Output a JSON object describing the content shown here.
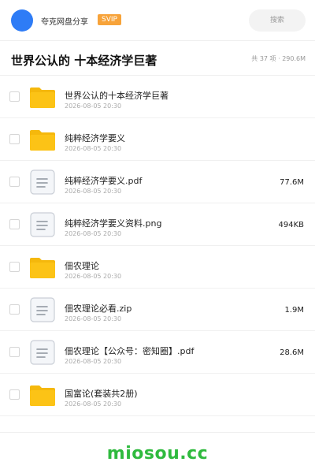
{
  "header": {
    "owner": "夸克网盘分享",
    "badge": "SVIP",
    "search_placeholder": "搜索"
  },
  "folder": {
    "title": "世界公认的 十本经济学巨著",
    "meta": "共 37 项 · 290.6M"
  },
  "files": [
    {
      "type": "folder-icon",
      "name": "世界公认的十本经济学巨著",
      "date": "2026-08-05 20:30",
      "size": ""
    },
    {
      "type": "folder-icon",
      "name": "纯粹经济学要义",
      "date": "2026-08-05 20:30",
      "size": ""
    },
    {
      "type": "document-icon",
      "name": "纯粹经济学要义.pdf",
      "date": "2026-08-05 20:30",
      "size": "77.6M"
    },
    {
      "type": "document-icon",
      "name": "纯粹经济学要义资料.png",
      "date": "2026-08-05 20:30",
      "size": "494KB"
    },
    {
      "type": "folder-icon",
      "name": "佃农理论",
      "date": "2026-08-05 20:30",
      "size": ""
    },
    {
      "type": "document-icon",
      "name": "佃农理论必看.zip",
      "date": "2026-08-05 20:30",
      "size": "1.9M"
    },
    {
      "type": "document-icon",
      "name": "佃农理论【公众号：密知圈】.pdf",
      "date": "2026-08-05 20:30",
      "size": "28.6M"
    },
    {
      "type": "folder-icon",
      "name": "国富论(套装共2册)",
      "date": "2026-08-05 20:30",
      "size": ""
    }
  ],
  "footer": {
    "brand": "miosou.cc"
  },
  "colors": {
    "avatar": "#2e7cf6",
    "badge": "#f7a33a",
    "folder": "#fcc316",
    "brand": "#2fba3e"
  }
}
